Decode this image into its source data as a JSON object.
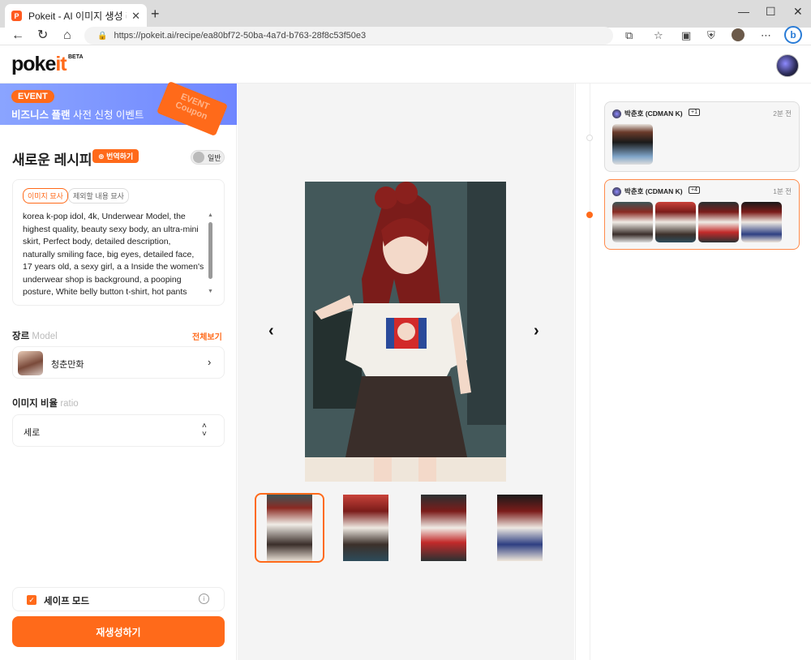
{
  "browser": {
    "tab_title": "Pokeit - AI 이미지 생성 레시피 공",
    "url": "https://pokeit.ai/recipe/ea80bf72-50ba-4a7d-b763-28f8c53f50e3"
  },
  "header": {
    "logo_main": "poke",
    "logo_accent": "it",
    "beta": "BETA"
  },
  "banner": {
    "badge": "EVENT",
    "text_bold": "비즈니스 플랜",
    "text_rest": "사전 신청 이벤트",
    "coupon": "EVENT Coupon"
  },
  "recipe": {
    "title": "새로운 레시피",
    "translate_label": "번역하기",
    "mode_label": "일반",
    "prompt_tabs": [
      "이미지 묘사",
      "제외할 내용 묘사"
    ],
    "prompt_text": "korea k-pop idol, 4k, Underwear Model, the highest quality, beauty sexy body, an ultra-mini skirt, Perfect body, detailed description, naturally smiling face, big eyes, detailed face, 17 years old, a sexy girl, a a Inside the women's underwear shop is background, a pooping posture, White belly button t-shirt, hot pants  blue & red, Big hips and thighs, hair color is black, skin tone is natural",
    "genre_label": "장르",
    "genre_sub": "Model",
    "view_all": "전체보기",
    "model_name": "청춘만화",
    "ratio_label": "이미지 비율",
    "ratio_sub": "ratio",
    "ratio_value": "세로",
    "safe_mode": "세이프 모드",
    "regen_button": "재생성하기"
  },
  "history": [
    {
      "user": "박춘호 (CDMAN K)",
      "count": "+1",
      "time": "2분 전"
    },
    {
      "user": "박춘호 (CDMAN K)",
      "count": "+4",
      "time": "1분 전"
    }
  ]
}
